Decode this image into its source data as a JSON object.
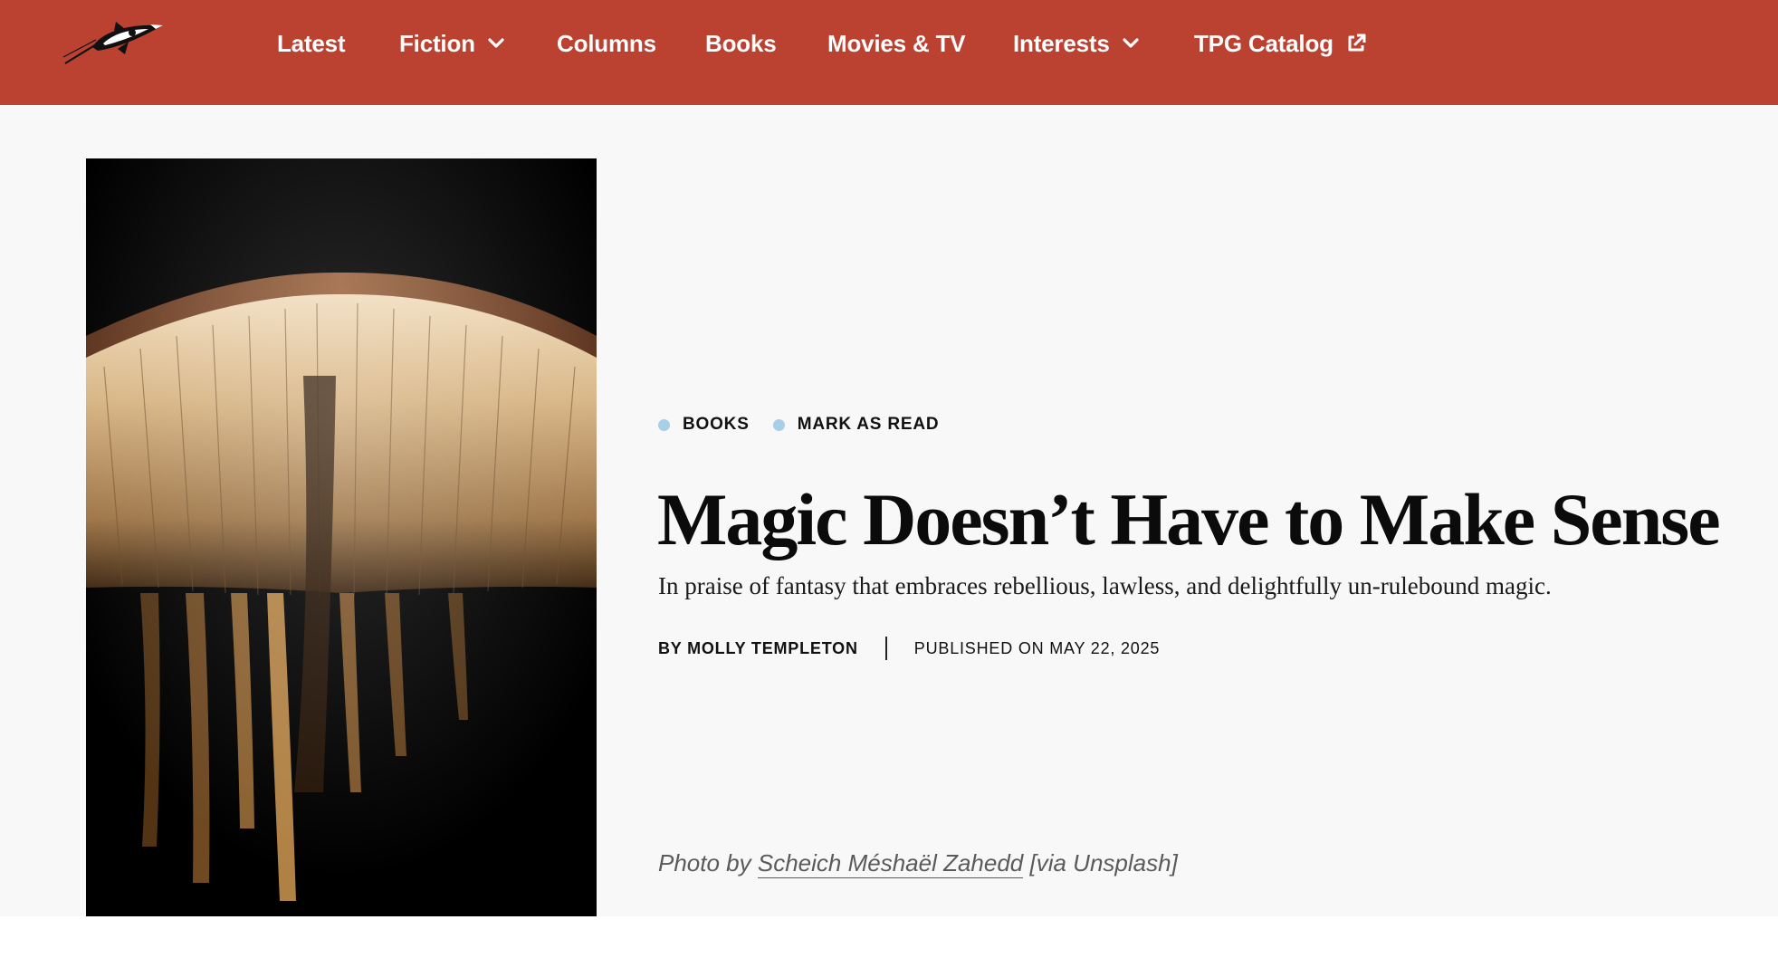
{
  "nav": {
    "items": [
      {
        "label": "Latest"
      },
      {
        "label": "Fiction",
        "icon": "chevron-down-icon"
      },
      {
        "label": "Columns"
      },
      {
        "label": "Books"
      },
      {
        "label": "Movies & TV"
      },
      {
        "label": "Interests",
        "icon": "chevron-down-icon"
      },
      {
        "label": "TPG Catalog",
        "icon": "external-link-icon"
      }
    ],
    "logo_icon": "rocket-logo-icon",
    "bg_color": "#bb4130"
  },
  "article": {
    "tags": [
      "BOOKS",
      "MARK AS READ"
    ],
    "tag_dot_color": "#a8cfe8",
    "title": "Magic Doesn’t Have to Make Sense",
    "dek": "In praise of fantasy that embraces rebellious, lawless, and delightfully un-rulebound magic.",
    "author": "BY MOLLY TEMPLETON",
    "published": "PUBLISHED ON MAY 22, 2025",
    "photo_credit": {
      "prefix": "Photo by ",
      "name": "Scheich Méshaël Zahedd",
      "suffix": " [via Unsplash]"
    }
  }
}
